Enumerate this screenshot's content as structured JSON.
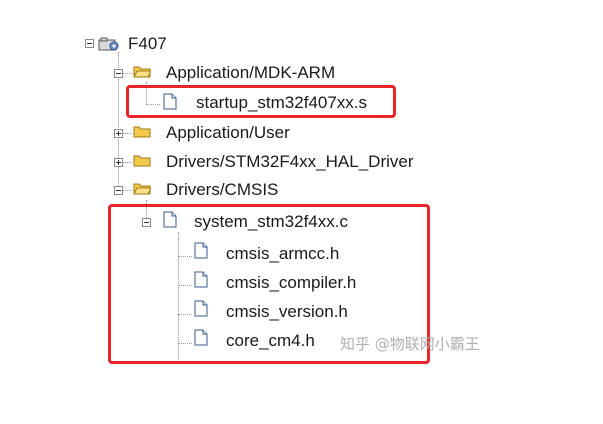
{
  "tree": {
    "root": {
      "label": "F407"
    },
    "groups": [
      {
        "label": "Application/MDK-ARM",
        "expanded": true
      },
      {
        "label": "Application/User",
        "expanded": false
      },
      {
        "label": "Drivers/STM32F4xx_HAL_Driver",
        "expanded": false
      },
      {
        "label": "Drivers/CMSIS",
        "expanded": true
      }
    ],
    "files": {
      "startup": "startup_stm32f407xx.s",
      "system": "system_stm32f4xx.c",
      "cmsis_armcc": "cmsis_armcc.h",
      "cmsis_compiler": "cmsis_compiler.h",
      "cmsis_version": "cmsis_version.h",
      "core_cm4": "core_cm4.h"
    }
  },
  "watermark": "知乎 @物联网小霸王",
  "colors": {
    "highlight_box": "#e8262b",
    "folder": "#f2c94c",
    "file_border": "#3a5a8a"
  }
}
